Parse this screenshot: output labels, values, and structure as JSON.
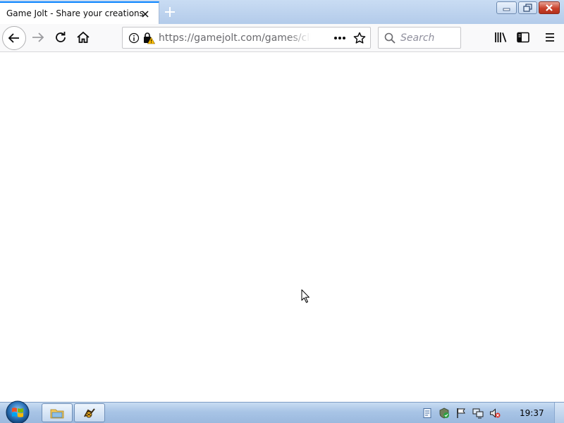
{
  "browser": {
    "tab": {
      "title": "Game Jolt - Share your creations",
      "close_icon": "close-icon"
    },
    "new_tab_icon": "plus-icon",
    "window_controls": [
      "minimize-icon",
      "maximize-icon",
      "close-icon"
    ],
    "nav": {
      "back_icon": "arrow-left-icon",
      "forward_icon": "arrow-right-icon",
      "reload_icon": "reload-icon",
      "home_icon": "home-icon"
    },
    "urlbar": {
      "url": "https://gamejolt.com/games/clickthecrystals",
      "info_icon": "info-icon",
      "lock_icon": "lock-warning-icon",
      "page_actions_icon": "more-dots-icon",
      "bookmark_icon": "star-icon"
    },
    "search": {
      "placeholder": "Search",
      "icon": "search-icon"
    },
    "toolbar_icons": [
      "library-icon",
      "sidebar-icon",
      "menu-icon"
    ]
  },
  "content": {
    "cursor": "arrow-cursor"
  },
  "taskbar": {
    "start_icon": "windows-start-icon",
    "pinned": [
      "file-explorer-icon",
      "game-app-icon"
    ],
    "tray_icons": [
      "document-icon",
      "security-shield-icon",
      "action-center-flag-icon",
      "network-icon",
      "volume-muted-icon"
    ],
    "clock": "19:37"
  },
  "colors": {
    "accent": "#0a84ff",
    "tabstrip": "#bcd1ee",
    "taskbar": "#a8c4e6",
    "warning": "#ffbf00"
  }
}
